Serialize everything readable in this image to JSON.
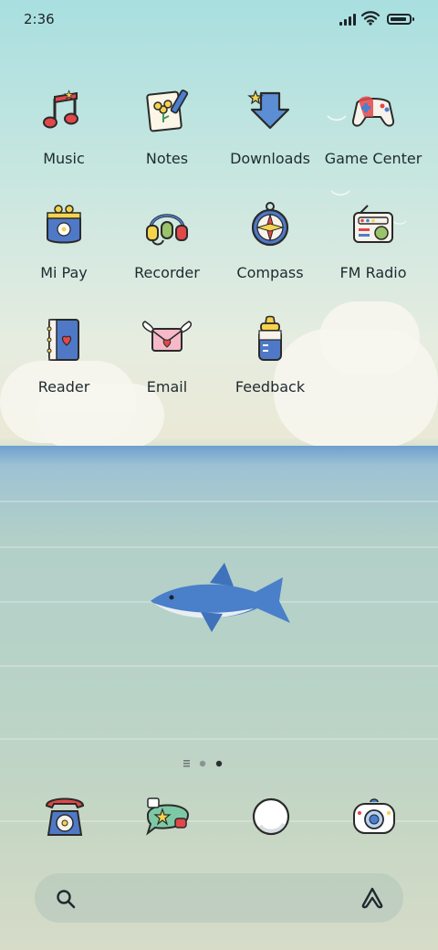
{
  "status_bar": {
    "time": "2:36",
    "battery_level": 0.9
  },
  "apps": [
    {
      "label": "Music",
      "icon": "music-note-icon"
    },
    {
      "label": "Notes",
      "icon": "notes-pencil-icon"
    },
    {
      "label": "Downloads",
      "icon": "download-arrow-icon"
    },
    {
      "label": "Game Center",
      "icon": "gamepad-icon"
    },
    {
      "label": "Mi Pay",
      "icon": "coin-purse-icon"
    },
    {
      "label": "Recorder",
      "icon": "headphones-mic-icon"
    },
    {
      "label": "Compass",
      "icon": "compass-icon"
    },
    {
      "label": "FM Radio",
      "icon": "radio-icon"
    },
    {
      "label": "Reader",
      "icon": "book-heart-icon"
    },
    {
      "label": "Email",
      "icon": "winged-envelope-icon"
    },
    {
      "label": "Feedback",
      "icon": "baby-bottle-icon"
    }
  ],
  "page_indicator": {
    "pages": 3,
    "current": 3
  },
  "dock": [
    {
      "icon": "telephone-icon"
    },
    {
      "icon": "chat-bubble-icon"
    },
    {
      "icon": "browser-ball-icon"
    },
    {
      "icon": "camera-icon"
    }
  ],
  "search": {
    "icon": "search-icon",
    "assistant_icon": "assistant-icon"
  }
}
